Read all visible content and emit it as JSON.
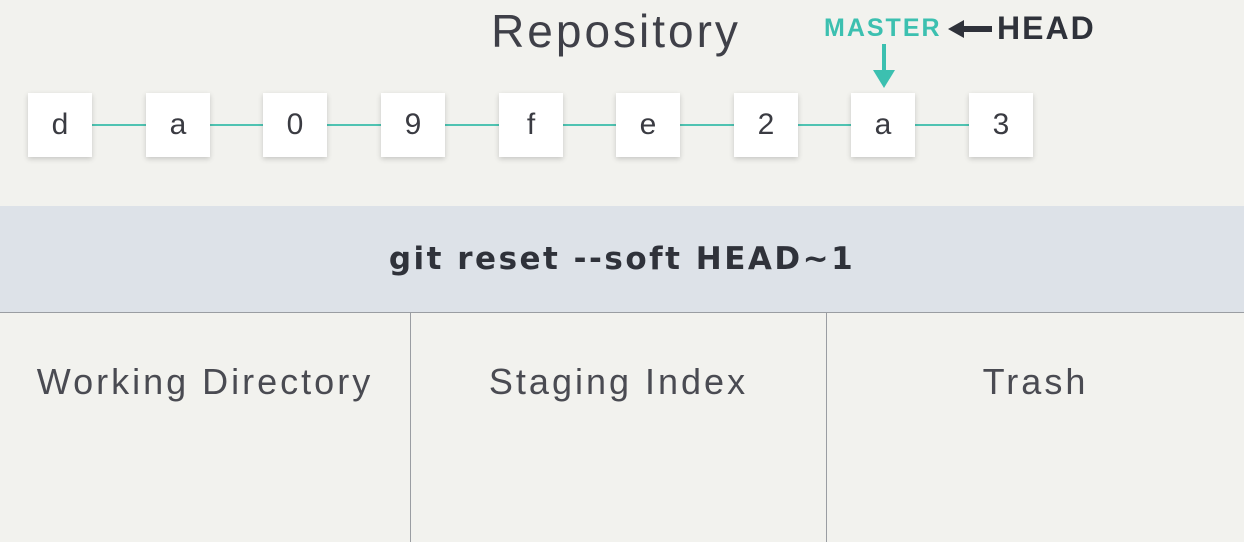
{
  "repository": {
    "title": "Repository",
    "master_label": "MASTER",
    "head_label": "HEAD",
    "commits": [
      "d",
      "a",
      "0",
      "9",
      "f",
      "e",
      "2",
      "a",
      "3"
    ],
    "accent_color": "#4fc3b2"
  },
  "command": "git reset --soft HEAD~1",
  "areas": [
    "Working Directory",
    "Staging Index",
    "Trash"
  ]
}
